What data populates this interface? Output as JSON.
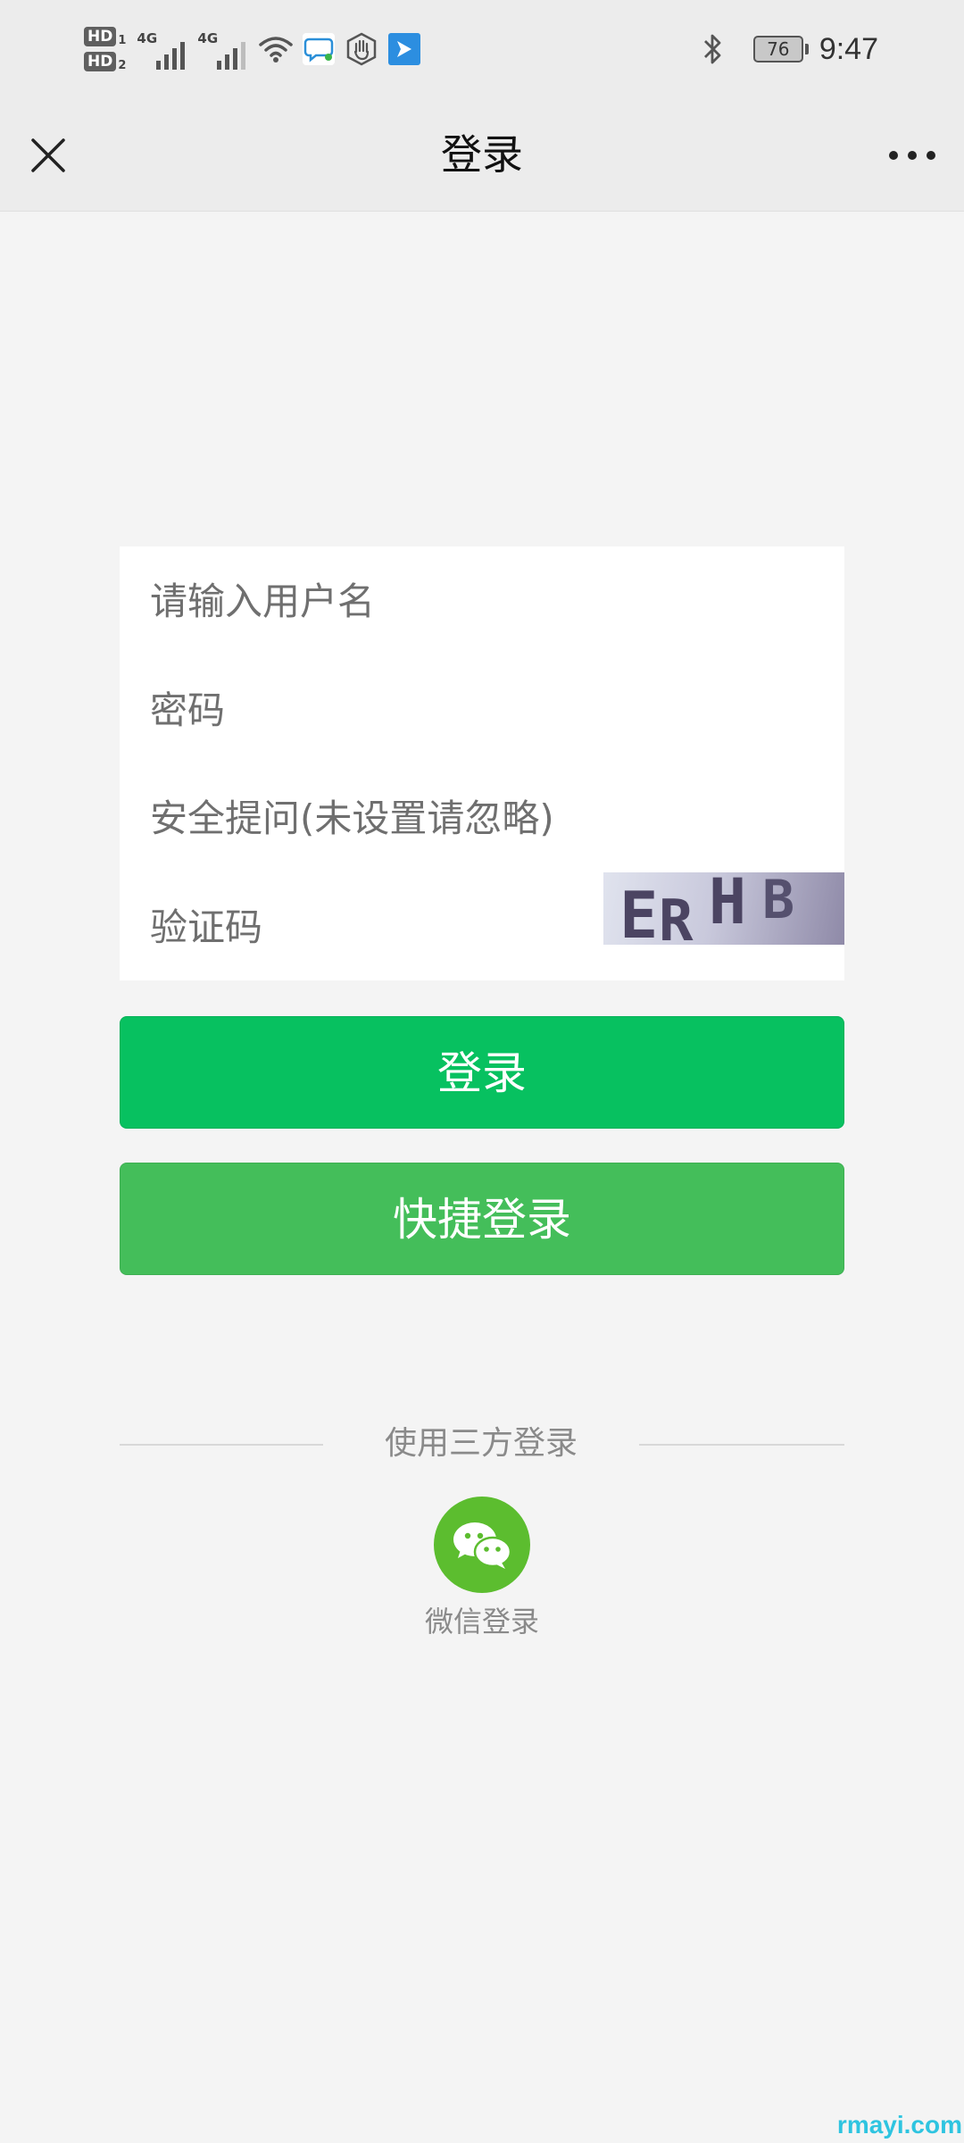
{
  "status_bar": {
    "sim1": {
      "badge": "HD",
      "sub": "1"
    },
    "sim2": {
      "badge": "HD",
      "sub": "2"
    },
    "signal1_label": "4G",
    "signal2_label": "4G",
    "battery_level": "76",
    "time": "9:47"
  },
  "nav": {
    "title": "登录"
  },
  "form": {
    "username_placeholder": "请输入用户名",
    "password_placeholder": "密码",
    "security_question_placeholder": "安全提问(未设置请忽略)",
    "captcha_placeholder": "验证码",
    "captcha_chars": [
      "E",
      "R",
      "H",
      "B"
    ]
  },
  "buttons": {
    "login_label": "登录",
    "quick_login_label": "快捷登录"
  },
  "third_party": {
    "divider_label": "使用三方登录",
    "wechat_label": "微信登录"
  },
  "watermark": "rmayi.com",
  "colors": {
    "login_button": "#07c160",
    "quick_login_button": "#44be5a",
    "wechat_icon_bg": "#5cbd2f"
  }
}
